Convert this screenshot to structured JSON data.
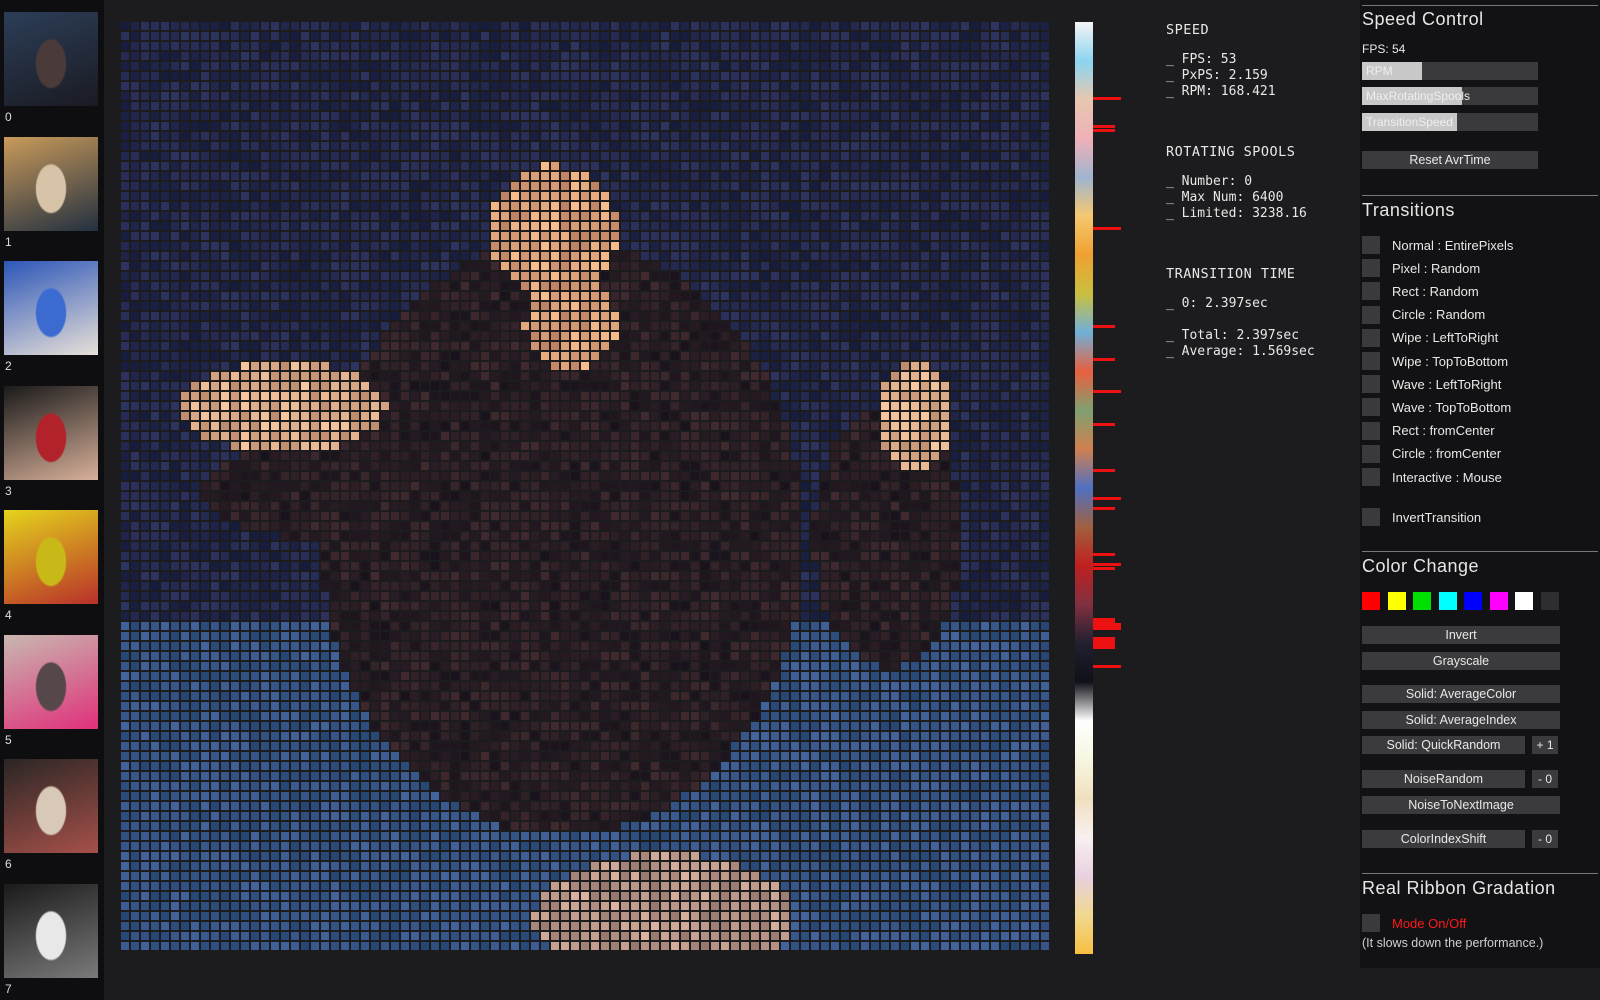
{
  "thumbnails": [
    {
      "index": "0",
      "colors": [
        "#2c3e58",
        "#4a3a3a",
        "#1a1a22"
      ]
    },
    {
      "index": "1",
      "colors": [
        "#c99a5a",
        "#d6c3a8",
        "#233040"
      ]
    },
    {
      "index": "2",
      "colors": [
        "#2c56b8",
        "#3b6ad0",
        "#e8e0d8"
      ]
    },
    {
      "index": "3",
      "colors": [
        "#1a1a1a",
        "#b2222a",
        "#d8b09a"
      ]
    },
    {
      "index": "4",
      "colors": [
        "#e4d41c",
        "#c8b818",
        "#b8302a"
      ]
    },
    {
      "index": "5",
      "colors": [
        "#c8b8b0",
        "#56484a",
        "#e0307a"
      ]
    },
    {
      "index": "6",
      "colors": [
        "#2a2624",
        "#d8c8b8",
        "#a6504a"
      ]
    },
    {
      "index": "7",
      "colors": [
        "#1a1a1a",
        "#e8e8e8",
        "#7a7a7a"
      ]
    }
  ],
  "stats": {
    "speed_title": "SPEED",
    "fps": "_ FPS: 53",
    "pxps": "_ PxPS: 2.159",
    "rpm": "_ RPM: 168.421",
    "spools_title": "ROTATING SPOOLS",
    "number": "_ Number: 0",
    "max_num": "_ Max Num: 6400",
    "limited": "_ Limited: 3238.16",
    "transition_title": "TRANSITION TIME",
    "t0": "_ 0: 2.397sec",
    "total": "_ Total: 2.397sec",
    "average": "_ Average: 1.569sec"
  },
  "speed_control": {
    "title": "Speed  Control",
    "fps": "FPS: 54",
    "sliders": [
      {
        "label": "RPM",
        "fraction": 0.34
      },
      {
        "label": "MaxRotatingSpools",
        "fraction": 0.57
      },
      {
        "label": "TransitionSpeed",
        "fraction": 0.54
      }
    ],
    "reset_label": "Reset  AvrTime"
  },
  "transitions": {
    "title": "Transitions",
    "options": [
      "Normal  :  EntirePixels",
      "Pixel  :  Random",
      "Rect  :  Random",
      "Circle  :  Random",
      "Wipe  :  LeftToRight",
      "Wipe  :  TopToBottom",
      "Wave  :  LeftToRight",
      "Wave  :  TopToBottom",
      "Rect  :  fromCenter",
      "Circle  :  fromCenter",
      "Interactive  :  Mouse"
    ],
    "invert_label": "InvertTransition"
  },
  "color_change": {
    "title": "Color  Change",
    "swatches": [
      "#ff0000",
      "#ffff00",
      "#00e000",
      "#00ffff",
      "#0000ff",
      "#ff00ff",
      "#ffffff",
      "#2e2e30"
    ],
    "invert": "Invert",
    "grayscale": "Grayscale",
    "solid_average_color": "Solid:  AverageColor",
    "solid_average_index": "Solid:  AverageIndex",
    "solid_quick_random": "Solid:  QuickRandom",
    "quick_random_step": "+ 1",
    "noise_random": "NoiseRandom",
    "noise_random_step": "- 0",
    "noise_to_next": "NoiseToNextImage",
    "color_index_shift": "ColorIndexShift",
    "color_index_step": "- 0"
  },
  "ribbon": {
    "title": "Real  Ribbon  Gradation",
    "mode_label": "Mode  On/Off",
    "note": "(It  slows  down  the  performance.)",
    "mode_color": "#ff1a1a",
    "colors": [
      "#f4f4f4",
      "#8cd4f0",
      "#e6c8b0",
      "#f0b0b8",
      "#a0b4d0",
      "#f4c870",
      "#f0a030",
      "#c8c040",
      "#70b0d8",
      "#e86040",
      "#80a070",
      "#d08050",
      "#5070c0",
      "#a06040",
      "#c02020",
      "#803040",
      "#202030",
      "#101018",
      "#ffffff",
      "#f6f6e0",
      "#f0e0c0",
      "#f8f0f0",
      "#e8d0e0",
      "#f0d890",
      "#f8c040"
    ],
    "marks": [
      0.08,
      0.11,
      0.115,
      0.22,
      0.325,
      0.36,
      0.395,
      0.43,
      0.48,
      0.51,
      0.52,
      0.57,
      0.58,
      0.585,
      0.64,
      0.645,
      0.66,
      0.665,
      0.69
    ]
  }
}
